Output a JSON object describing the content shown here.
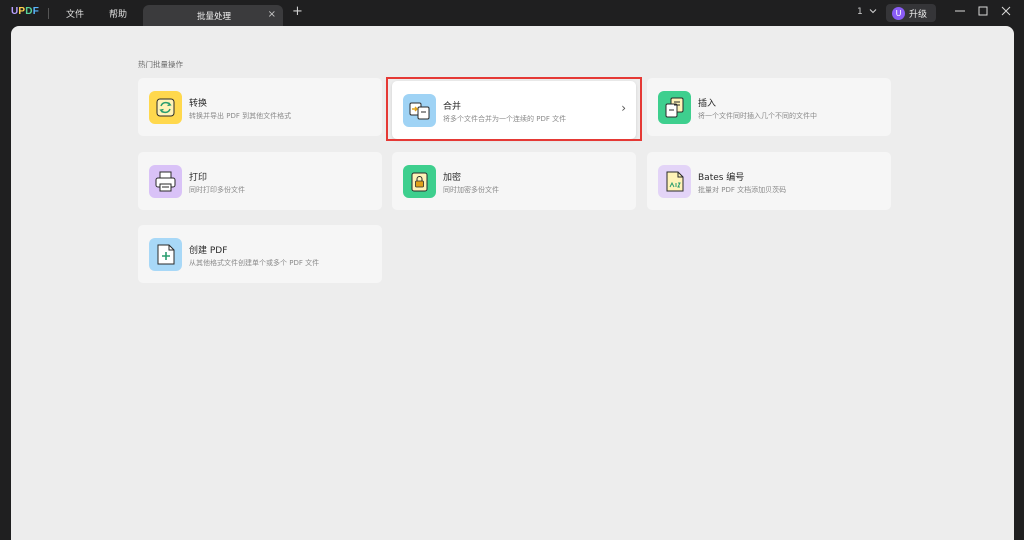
{
  "app": {
    "logo": "UPDF",
    "menu": {
      "file": "文件",
      "help": "帮助"
    },
    "tab": {
      "title": "批量处理",
      "close_glyph": "×"
    },
    "new_tab_glyph": "+",
    "window_count": "1",
    "upgrade": {
      "avatar_letter": "U",
      "label": "升级"
    },
    "window_controls": {
      "minimize": "—",
      "maximize": "☐",
      "close": "✕"
    }
  },
  "section_title": "热门批量操作",
  "cards": [
    {
      "title": "转换",
      "desc": "转换并导出 PDF 到其他文件格式",
      "icon": "convert-icon",
      "color": "#ffd84d"
    },
    {
      "title": "合并",
      "desc": "将多个文件合并为一个连续的 PDF 文件",
      "icon": "merge-icon",
      "color": "#9fd3f5",
      "chevron": "›"
    },
    {
      "title": "插入",
      "desc": "将一个文件同时插入几个不同的文件中",
      "icon": "insert-icon",
      "color": "#3ecf8e"
    },
    {
      "title": "打印",
      "desc": "同时打印多份文件",
      "icon": "print-icon",
      "color": "#d9c2f7"
    },
    {
      "title": "加密",
      "desc": "同时加密多份文件",
      "icon": "lock-icon",
      "color": "#3ecf8e"
    },
    {
      "title": "Bates 编号",
      "desc": "批量对 PDF 文档添加贝茨码",
      "icon": "bates-number-icon",
      "color": "#e3d4f7"
    },
    {
      "title": "创建 PDF",
      "desc": "从其他格式文件创建单个或多个 PDF 文件",
      "icon": "create-pdf-icon",
      "color": "#a8d8f7"
    }
  ]
}
